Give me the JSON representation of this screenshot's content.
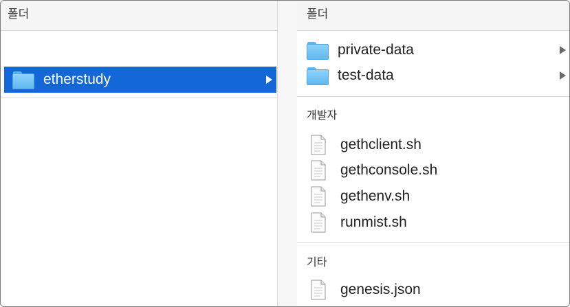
{
  "left_column": {
    "header": "폴더",
    "items": [
      {
        "label": "etherstudy",
        "icon": "folder-icon",
        "selected": true,
        "has_children": true
      }
    ]
  },
  "right_column": {
    "folders_header": "폴더",
    "folders": [
      {
        "label": "private-data",
        "icon": "folder-icon",
        "has_children": true
      },
      {
        "label": "test-data",
        "icon": "folder-icon",
        "has_children": true
      }
    ],
    "developer_section": {
      "title": "개발자",
      "files": [
        {
          "label": "gethclient.sh",
          "icon": "document-icon"
        },
        {
          "label": "gethconsole.sh",
          "icon": "document-icon"
        },
        {
          "label": "gethenv.sh",
          "icon": "document-icon"
        },
        {
          "label": "runmist.sh",
          "icon": "document-icon"
        }
      ]
    },
    "other_section": {
      "title": "기타",
      "files": [
        {
          "label": "genesis.json",
          "icon": "document-icon"
        }
      ]
    }
  },
  "colors": {
    "selection": "#1467d6",
    "folder": "#5eb9ef",
    "header_bg": "#f5f5f5"
  }
}
